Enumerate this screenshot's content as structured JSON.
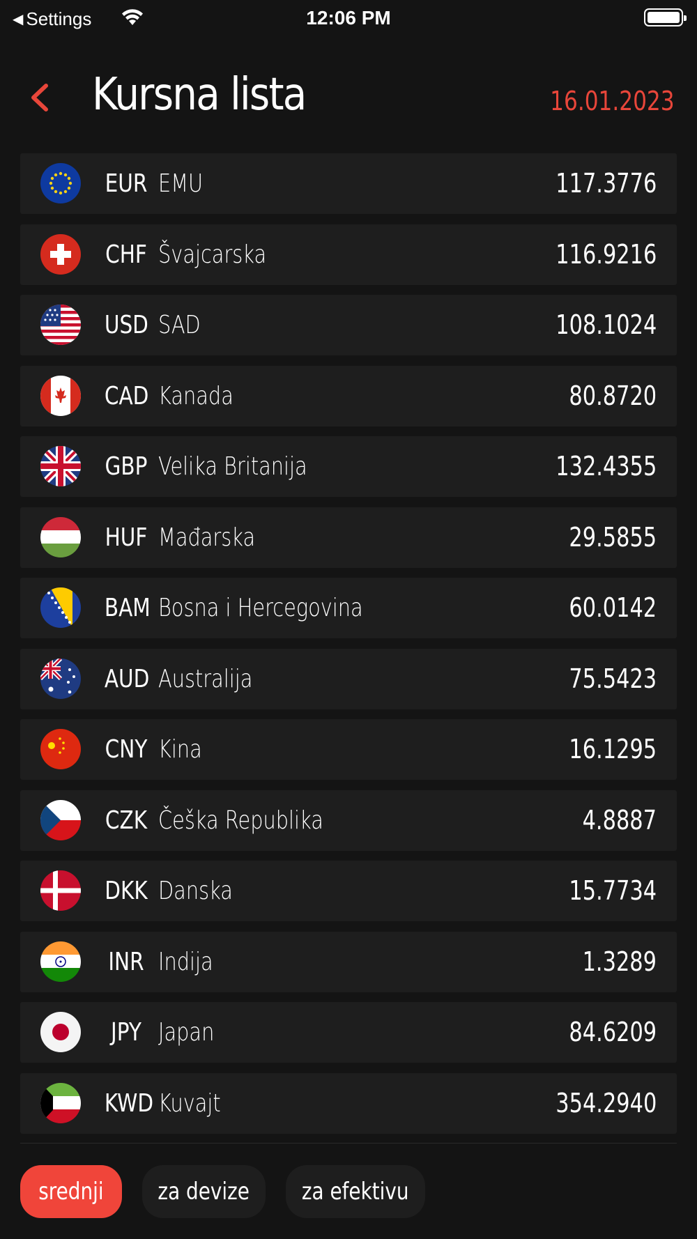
{
  "status_bar": {
    "back_label": "Settings",
    "time": "12:06 PM"
  },
  "header": {
    "title": "Kursna lista",
    "date": "16.01.2023",
    "accent_color": "#e8463a"
  },
  "rates": [
    {
      "code": "EUR",
      "name": "EMU",
      "rate": "117.3776",
      "flag_icon": "eu-flag-icon"
    },
    {
      "code": "CHF",
      "name": "Švajcarska",
      "rate": "116.9216",
      "flag_icon": "switzerland-flag-icon"
    },
    {
      "code": "USD",
      "name": "SAD",
      "rate": "108.1024",
      "flag_icon": "usa-flag-icon"
    },
    {
      "code": "CAD",
      "name": "Kanada",
      "rate": "80.8720",
      "flag_icon": "canada-flag-icon"
    },
    {
      "code": "GBP",
      "name": "Velika Britanija",
      "rate": "132.4355",
      "flag_icon": "uk-flag-icon"
    },
    {
      "code": "HUF",
      "name": "Mađarska",
      "rate": "29.5855",
      "flag_icon": "hungary-flag-icon"
    },
    {
      "code": "BAM",
      "name": "Bosna i Hercegovina",
      "rate": "60.0142",
      "flag_icon": "bosnia-flag-icon"
    },
    {
      "code": "AUD",
      "name": "Australija",
      "rate": "75.5423",
      "flag_icon": "australia-flag-icon"
    },
    {
      "code": "CNY",
      "name": "Kina",
      "rate": "16.1295",
      "flag_icon": "china-flag-icon"
    },
    {
      "code": "CZK",
      "name": "Češka Republika",
      "rate": "4.8887",
      "flag_icon": "czech-flag-icon"
    },
    {
      "code": "DKK",
      "name": "Danska",
      "rate": "15.7734",
      "flag_icon": "denmark-flag-icon"
    },
    {
      "code": "INR",
      "name": "Indija",
      "rate": "1.3289",
      "flag_icon": "india-flag-icon"
    },
    {
      "code": "JPY",
      "name": "Japan",
      "rate": "84.6209",
      "flag_icon": "japan-flag-icon"
    },
    {
      "code": "KWD",
      "name": "Kuvajt",
      "rate": "354.2940",
      "flag_icon": "kuwait-flag-icon"
    }
  ],
  "tabs": [
    {
      "label": "srednji",
      "active": true
    },
    {
      "label": "za devize",
      "active": false
    },
    {
      "label": "za efektivu",
      "active": false
    }
  ]
}
